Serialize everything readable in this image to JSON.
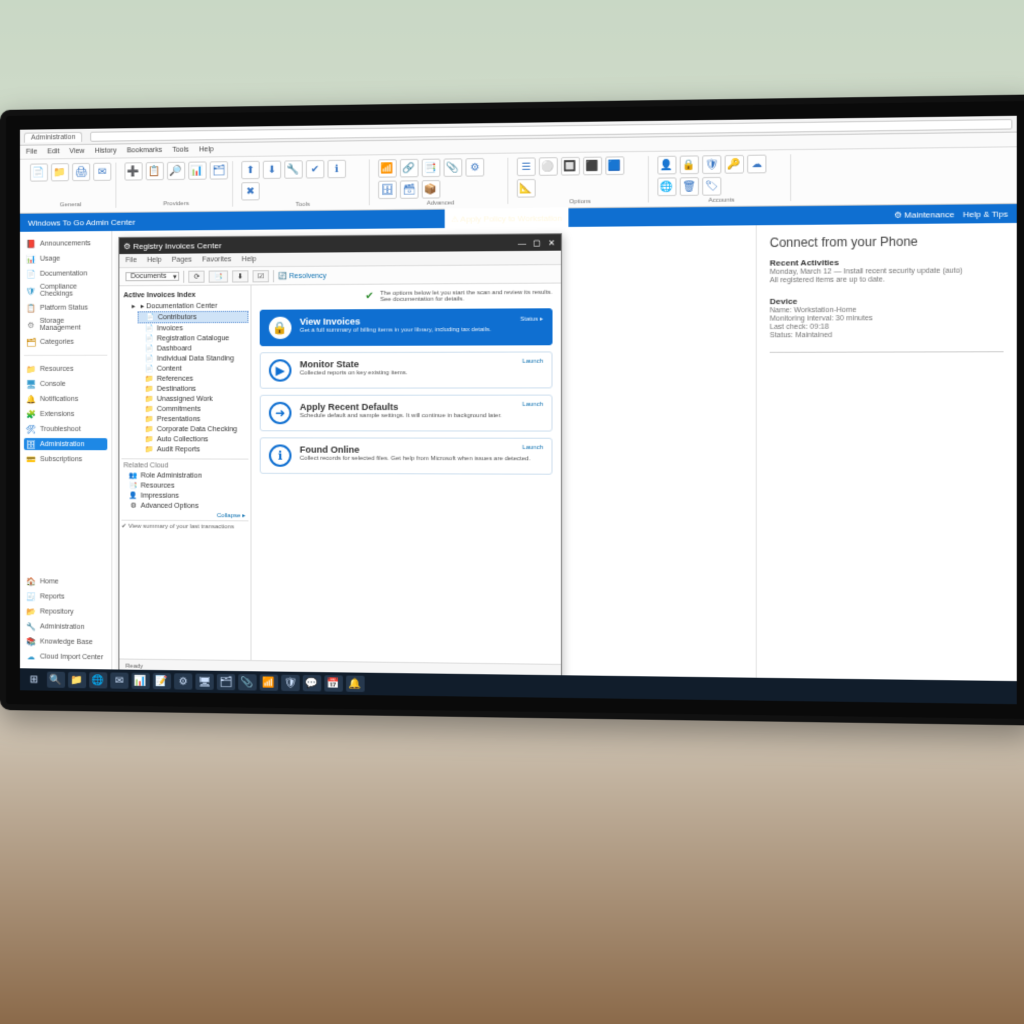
{
  "browser": {
    "tab": "Administration"
  },
  "appmenu": {
    "items": [
      "File",
      "Edit",
      "View",
      "History",
      "Bookmarks",
      "Tools",
      "Help"
    ]
  },
  "ribbon": {
    "groups": [
      {
        "label": "General",
        "icons": [
          "📄",
          "📁",
          "🖨",
          "✉"
        ]
      },
      {
        "label": "Providers",
        "icons": [
          "➕",
          "📋",
          "🔎",
          "📊",
          "🗂"
        ]
      },
      {
        "label": "Tools",
        "icons": [
          "⬆",
          "⬇",
          "🔧",
          "✔",
          "ℹ",
          "✖"
        ]
      },
      {
        "label": "Advanced",
        "icons": [
          "📶",
          "🔗",
          "📑",
          "📎",
          "⚙",
          "🗄",
          "🗃",
          "📦"
        ]
      },
      {
        "label": "Options",
        "icons": [
          "☰",
          "⚪",
          "🔲",
          "⬛",
          "🟦",
          "📐"
        ]
      },
      {
        "label": "Accounts",
        "icons": [
          "👤",
          "🔒",
          "🛡",
          "🔑",
          "☁",
          "🌐",
          "🗑",
          "🏷"
        ]
      }
    ]
  },
  "banner": {
    "left": "Windows To Go Admin Center",
    "center": "⚠  Apply Policy to Workstation",
    "rightA": "⚙ Maintenance",
    "rightB": "Help & Tips"
  },
  "outer_sidebar": {
    "top": [
      {
        "icon": "📕",
        "color": "#d33",
        "label": "Announcements"
      },
      {
        "icon": "📊",
        "color": "#2a7",
        "label": "Usage"
      },
      {
        "icon": "📄",
        "color": "#39c",
        "label": "Documentation"
      },
      {
        "icon": "🛡",
        "color": "#39c",
        "label": "Compliance Checkings"
      },
      {
        "icon": "📋",
        "color": "#aa8",
        "label": "Platform Status"
      },
      {
        "icon": "⚙",
        "color": "#888",
        "label": "Storage Management"
      },
      {
        "icon": "🗂",
        "color": "#c80",
        "label": "Categories"
      }
    ],
    "mid": [
      {
        "icon": "📁",
        "color": "#c80",
        "label": "Resources"
      },
      {
        "icon": "🖥",
        "color": "#39c",
        "label": "Console"
      },
      {
        "icon": "🔔",
        "color": "#c33",
        "label": "Notifications"
      },
      {
        "icon": "🧩",
        "color": "#6b4",
        "label": "Extensions"
      },
      {
        "icon": "🛠",
        "color": "#27c",
        "label": "Troubleshoot"
      },
      {
        "icon": "🗄",
        "color": "#27c",
        "label": "Administration",
        "selected": true
      },
      {
        "icon": "💳",
        "color": "#888",
        "label": "Subscriptions"
      }
    ],
    "bottom": [
      {
        "icon": "🏠",
        "color": "#39c",
        "label": "Home"
      },
      {
        "icon": "🧾",
        "color": "#888",
        "label": "Reports"
      },
      {
        "icon": "📂",
        "color": "#c80",
        "label": "Repository"
      },
      {
        "icon": "🔧",
        "color": "#888",
        "label": "Administration"
      },
      {
        "icon": "📚",
        "color": "#39c",
        "label": "Knowledge Base"
      },
      {
        "icon": "☁",
        "color": "#39c",
        "label": "Cloud Import Center"
      }
    ]
  },
  "subwin": {
    "title": "⚙  Registry Invoices Center",
    "menu": [
      "File",
      "Help",
      "Pages",
      "Favorites",
      "Help"
    ],
    "dropdown": "Documents",
    "toolbar": {
      "btnA": "⟳",
      "btnB": "📑",
      "btnC": "⬇",
      "btnD": "☑",
      "linkLabel": "🔄  Resolvency"
    },
    "tree_header": "Active Invoices Index",
    "tree": {
      "root": "▸ Documentation Center",
      "selected": "Contributors",
      "nodes": [
        {
          "icon": "📄",
          "label": "Invoices"
        },
        {
          "icon": "📄",
          "label": "Registration Catalogue"
        },
        {
          "icon": "📄",
          "label": "Dashboard"
        },
        {
          "icon": "📄",
          "label": "Individual Data Standing"
        },
        {
          "icon": "📄",
          "label": "Content"
        },
        {
          "icon": "📁",
          "label": "References"
        },
        {
          "icon": "📁",
          "label": "Destinations"
        },
        {
          "icon": "📁",
          "label": "Unassigned Work"
        },
        {
          "icon": "📁",
          "label": "Commitments"
        },
        {
          "icon": "📁",
          "label": "Presentations"
        },
        {
          "icon": "📁",
          "label": "Corporate Data Checking"
        },
        {
          "icon": "📁",
          "label": "Auto Collections"
        },
        {
          "icon": "📁",
          "label": "Audit Reports"
        }
      ],
      "section2_label": "Related Cloud",
      "section2": [
        {
          "icon": "👥",
          "label": "Role Administration"
        },
        {
          "icon": "📑",
          "label": "Resources"
        },
        {
          "icon": "👤",
          "label": "Impressions"
        },
        {
          "icon": "⚙",
          "label": "Advanced Options"
        }
      ],
      "footer_link": "Collapse ▸",
      "footer_line": "✔  View summary of your last transactions"
    },
    "hint": {
      "lineA": "The options below let you start the scan and review its results.",
      "lineB": "See documentation for details."
    },
    "tasks": [
      {
        "icon": "🔒",
        "title": "View Invoices",
        "desc": "Get a full summary of billing items in your library, including tax details.",
        "link": "Status ▸",
        "primary": true
      },
      {
        "icon": "▶",
        "title": "Monitor State",
        "desc": "Collected reports on key existing items.",
        "link": "Launch"
      },
      {
        "icon": "➜",
        "title": "Apply Recent Defaults",
        "desc": "Schedule default and sample settings. It will continue in background later.",
        "link": "Launch"
      },
      {
        "icon": "ℹ",
        "title": "Found Online",
        "desc": "Collect records for selected files. Get help from Microsoft when issues are detected.",
        "link": "Launch"
      }
    ],
    "status": "Ready"
  },
  "right_panel": {
    "title": "Connect from your Phone",
    "section1_label": "Recent Activities",
    "section1_lines": [
      "Monday, March 12  —  Install recent security update (auto)",
      "All registered items are up to date."
    ],
    "section2_label": "Device",
    "section2_lines": [
      "Name: Workstation-Home",
      "Monitoring interval: 30 minutes",
      "Last check: 09:18",
      "Status: Maintained"
    ]
  },
  "taskbar": {
    "icons": [
      "⊞",
      "🔍",
      "📁",
      "🌐",
      "✉",
      "📊",
      "📝",
      "⚙",
      "🖥",
      "🗂",
      "📎",
      "📶",
      "🛡",
      "💬",
      "📅",
      "🔔"
    ]
  }
}
